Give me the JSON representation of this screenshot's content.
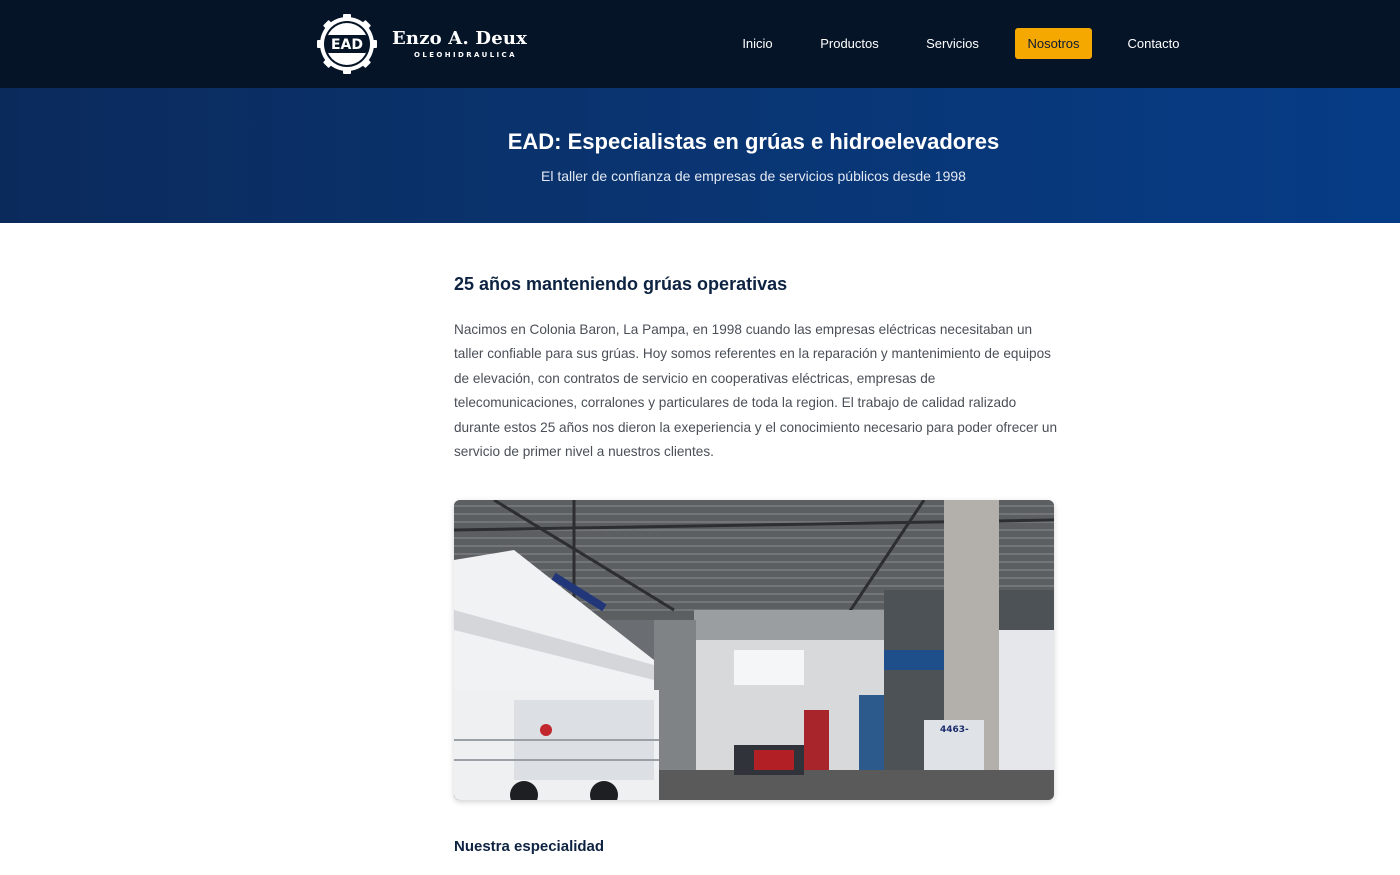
{
  "header": {
    "logo_monogram": "EAD",
    "brand_name": "Enzo A. Deux",
    "brand_tagline": "OLEOHIDRAULICA",
    "nav": [
      {
        "label": "Inicio",
        "active": false
      },
      {
        "label": "Productos",
        "active": false
      },
      {
        "label": "Servicios",
        "active": false
      },
      {
        "label": "Nosotros",
        "active": true
      },
      {
        "label": "Contacto",
        "active": false
      }
    ]
  },
  "hero": {
    "title": "EAD: Especialistas en grúas e hidroelevadores",
    "subtitle": "El taller de confianza de empresas de servicios públicos desde 1998"
  },
  "main": {
    "section_title": "25 años manteniendo grúas operativas",
    "intro": "Nacimos en Colonia Baron, La Pampa, en 1998 cuando las empresas eléctricas necesitaban un taller confiable para sus grúas. Hoy somos referentes en la reparación y mantenimiento de equipos de elevación, con contratos de servicio en cooperativas eléctricas, empresas de telecomunicaciones, corralones y particulares de toda la region. El trabajo de calidad ralizado durante estos 25 años nos dieron la exeperiencia y el conocimiento necesario para poder ofrecer un servicio de primer nivel a nuestros clientes.",
    "photo_plate": "4463-",
    "subsection_title": "Nuestra especialidad"
  },
  "colors": {
    "topbar_bg": "#061427",
    "hero_bg_start": "#0b2a5c",
    "hero_bg_end": "#063c86",
    "accent": "#f5a800",
    "heading": "#0d2341",
    "body_text": "#4a4f57"
  },
  "icons": {
    "logo": "gear-logo-icon"
  }
}
